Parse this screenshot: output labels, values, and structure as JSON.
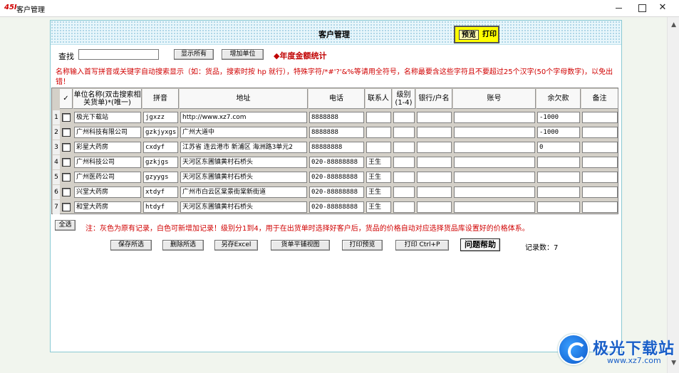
{
  "window": {
    "logo_text": "45I",
    "title": "客户管理",
    "minimize": "—",
    "close": "✕"
  },
  "panel": {
    "title": "客户管理",
    "preview_label": "预览",
    "print_label": "打印"
  },
  "search": {
    "label": "查找",
    "value": "",
    "show_all_label": "显示所有",
    "add_unit_label": "增加单位"
  },
  "annual_stats_label": "◆年度金额统计",
  "notice_top": "名称输入首写拼音或关键字自动搜索显示（如：货品，搜索时按 hp 就行），特殊字符/*#'?'&%等请用全符号，名称最要含这些字符且不要超过25个汉字(50个字母数字)，以免出错！",
  "table": {
    "columns": [
      "✓",
      "单位名称(双击搜索相关货单)*(唯一)",
      "拼音",
      "地址",
      "电话",
      "联系人",
      "级别(1-4)",
      "银行/户名",
      "账号",
      "余欠款",
      "备注"
    ],
    "rows": [
      {
        "num": "1",
        "name": "极光下载站",
        "pinyin": "jgxzz",
        "address": "http://www.xz7.com",
        "phone": "8888888",
        "contact": "",
        "level": "",
        "bank": "",
        "account": "",
        "balance": "-1000",
        "remark": ""
      },
      {
        "num": "2",
        "name": "广州科技有限公司",
        "pinyin": "gzkjyxgs",
        "address": "广州大道中",
        "phone": "8888888",
        "contact": "",
        "level": "",
        "bank": "",
        "account": "",
        "balance": "-1000",
        "remark": ""
      },
      {
        "num": "3",
        "name": "彩星大药房",
        "pinyin": "cxdyf",
        "address": "江苏省 连云港市 新浦区 海洲路3单元2",
        "phone": "88888888",
        "contact": "",
        "level": "",
        "bank": "",
        "account": "",
        "balance": "0",
        "remark": ""
      },
      {
        "num": "4",
        "name": "广州科技公司",
        "pinyin": "gzkjgs",
        "address": "天河区东圃镇黄村石桥头",
        "phone": "020-88888888",
        "contact": "王生",
        "level": "",
        "bank": "",
        "account": "",
        "balance": "",
        "remark": ""
      },
      {
        "num": "5",
        "name": "广州医药公司",
        "pinyin": "gzyygs",
        "address": "天河区东圃镇黄村石桥头",
        "phone": "020-88888888",
        "contact": "王生",
        "level": "",
        "bank": "",
        "account": "",
        "balance": "",
        "remark": ""
      },
      {
        "num": "6",
        "name": "兴堂大药房",
        "pinyin": "xtdyf",
        "address": "广州市白云区棠景街棠新街道",
        "phone": "020-88888888",
        "contact": "王生",
        "level": "",
        "bank": "",
        "account": "",
        "balance": "",
        "remark": ""
      },
      {
        "num": "7",
        "name": "和堂大药房",
        "pinyin": "htdyf",
        "address": "天河区东圃镇黄村石桥头",
        "phone": "020-88888888",
        "contact": "王生",
        "level": "",
        "bank": "",
        "account": "",
        "balance": "",
        "remark": ""
      }
    ]
  },
  "bottom": {
    "select_all_label": "全选",
    "notice": "注：灰色为原有记录，白色可新增加记录！级别分1到4，用于在出货单时选择好客户后，货品的价格自动对应选择货品库设置好的价格体系。",
    "save_selected_label": "保存所选",
    "delete_selected_label": "删除所选",
    "save_excel_label": "另存Excel",
    "plain_view_label": "货单平铺视图",
    "print_preview_label": "打印预览",
    "print_ctrl_label": "打印 Ctrl+P",
    "help_label": "问题帮助",
    "record_count_label": "记录数：7"
  },
  "watermark": {
    "text": "极光下载站",
    "url": "www.xz7.com"
  }
}
